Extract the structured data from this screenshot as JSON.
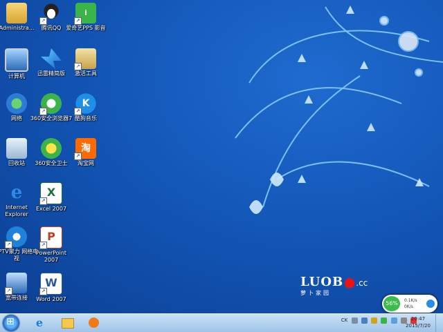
{
  "desktop_icons": [
    {
      "label": "Administra..."
    },
    {
      "label": "腾讯QQ"
    },
    {
      "label": "爱奇艺PPS 影音"
    },
    {
      "label": "计算机"
    },
    {
      "label": "迅雷精简版"
    },
    {
      "label": "激活工具"
    },
    {
      "label": "网络"
    },
    {
      "label": "360安全浏览器7"
    },
    {
      "label": "酷狗音乐"
    },
    {
      "label": "回收站"
    },
    {
      "label": "360安全卫士"
    },
    {
      "label": "淘宝网"
    },
    {
      "label": "Internet Explorer"
    },
    {
      "label": "Excel 2007"
    },
    {
      "label": "PPTV聚力 网络电视"
    },
    {
      "label": "PowerPoint 2007"
    },
    {
      "label": "宽带连接"
    },
    {
      "label": "Word 2007"
    }
  ],
  "logo": {
    "brand": "LUOB",
    "domain": ".cc",
    "subtitle": "萝卜家园"
  },
  "net_widget": {
    "percent": "56%",
    "up": "0.1K/s",
    "down": "0K/s"
  },
  "taskbar": {
    "tray_lang": "CK",
    "time": "20:47",
    "date": "2015/7/20"
  },
  "colors": {
    "desktop": "#1357b8",
    "taskbar": "#b6d3f0",
    "accent": "#3cba4a"
  }
}
